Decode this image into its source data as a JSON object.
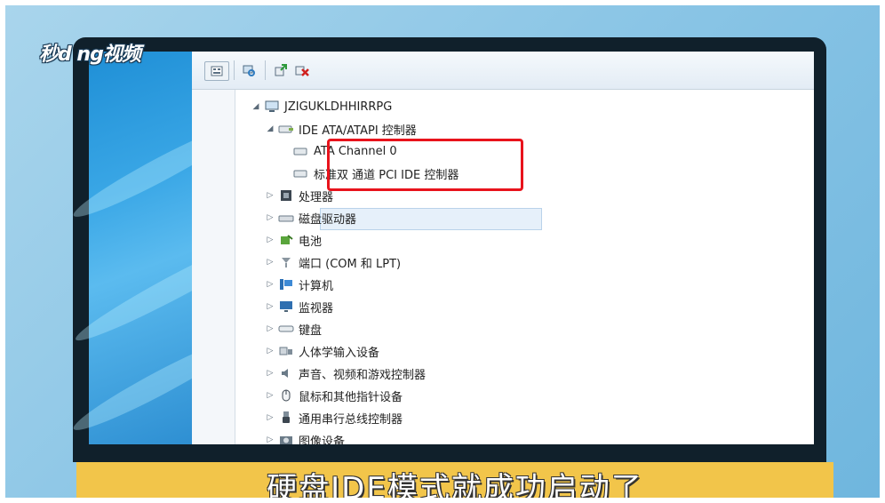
{
  "watermark": {
    "logo_text": "秒d ng视频"
  },
  "toolbar": {
    "icons": [
      "show-hidden-icon",
      "scan-icon",
      "update-driver-icon",
      "uninstall-icon"
    ]
  },
  "tree": {
    "root": "JZIGUKLDHHIRRPG",
    "ide_group": "IDE ATA/ATAPI 控制器",
    "ide_children": [
      "ATA Channel 0",
      "标准双 通道 PCI IDE 控制器"
    ],
    "categories": [
      "处理器",
      "磁盘驱动器",
      "电池",
      "端口 (COM 和 LPT)",
      "计算机",
      "监视器",
      "键盘",
      "人体学输入设备",
      "声音、视频和游戏控制器",
      "鼠标和其他指针设备",
      "通用串行总线控制器",
      "图像设备"
    ]
  },
  "caption": "硬盘IDE模式就成功启动了",
  "colors": {
    "highlight": "#e8131c",
    "caption_bg": "#f2c54a",
    "desktop": "#3aa7e6"
  }
}
